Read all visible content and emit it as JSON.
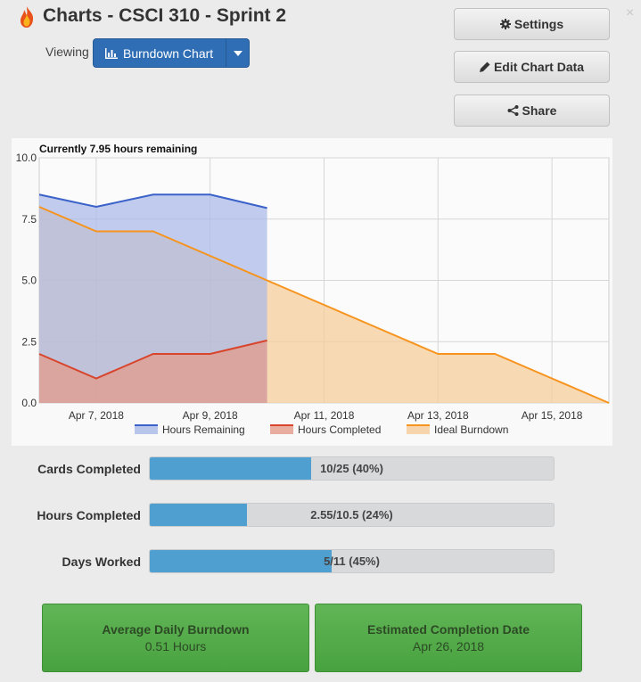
{
  "app": {
    "title": "Charts - CSCI 310 - Sprint 2",
    "logo_icon": "flame-icon",
    "close_glyph": "×"
  },
  "viewing": {
    "label": "Viewing",
    "selected": "Burndown Chart"
  },
  "buttons": {
    "settings": "Settings",
    "edit": "Edit Chart Data",
    "share": "Share"
  },
  "chart_data": {
    "type": "area",
    "title": "Currently 7.95 hours remaining",
    "x_dates": [
      "Apr 6",
      "Apr 7",
      "Apr 8",
      "Apr 9",
      "Apr 10",
      "Apr 11",
      "Apr 12",
      "Apr 13",
      "Apr 14",
      "Apr 15",
      "Apr 16"
    ],
    "xtick_labels": [
      "Apr 7, 2018",
      "Apr 9, 2018",
      "Apr 11, 2018",
      "Apr 13, 2018",
      "Apr 15, 2018"
    ],
    "xtick_dates": [
      "Apr 7",
      "Apr 9",
      "Apr 11",
      "Apr 13",
      "Apr 15"
    ],
    "ylim": [
      0,
      10
    ],
    "ytick_labels": [
      "10.0",
      "7.5",
      "5.0",
      "2.5",
      "0.0"
    ],
    "ytick_values": [
      10,
      7.5,
      5,
      2.5,
      0
    ],
    "grid": true,
    "legend_position": "bottom",
    "series": [
      {
        "name": "Hours Remaining",
        "color": "#3a62c8",
        "fill": "#a9b9e8",
        "x": [
          "Apr 6",
          "Apr 7",
          "Apr 8",
          "Apr 9",
          "Apr 10"
        ],
        "values": [
          8.5,
          8.0,
          8.5,
          8.5,
          7.95
        ]
      },
      {
        "name": "Hours Completed",
        "color": "#d8452c",
        "fill": "#e59a88",
        "x": [
          "Apr 6",
          "Apr 7",
          "Apr 8",
          "Apr 9",
          "Apr 10"
        ],
        "values": [
          2.0,
          1.0,
          2.0,
          2.0,
          2.55
        ]
      },
      {
        "name": "Ideal Burndown",
        "color": "#f7941e",
        "fill": "#f5cc98",
        "x": [
          "Apr 6",
          "Apr 7",
          "Apr 8",
          "Apr 9",
          "Apr 10",
          "Apr 11",
          "Apr 12",
          "Apr 13",
          "Apr 14",
          "Apr 15",
          "Apr 16"
        ],
        "values": [
          8.0,
          7.0,
          7.0,
          6.0,
          5.0,
          4.0,
          3.0,
          2.0,
          2.0,
          1.0,
          0.0
        ]
      }
    ]
  },
  "stats": [
    {
      "label": "Cards Completed",
      "text": "10/25 (40%)",
      "fraction": 0.4
    },
    {
      "label": "Hours Completed",
      "text": "2.55/10.5 (24%)",
      "fraction": 0.24
    },
    {
      "label": "Days Worked",
      "text": "5/11 (45%)",
      "fraction": 0.45
    }
  ],
  "summary": {
    "burndown_label": "Average Daily Burndown",
    "burndown_value": "0.51 Hours",
    "completion_label": "Estimated Completion Date",
    "completion_value": "Apr 26, 2018"
  }
}
